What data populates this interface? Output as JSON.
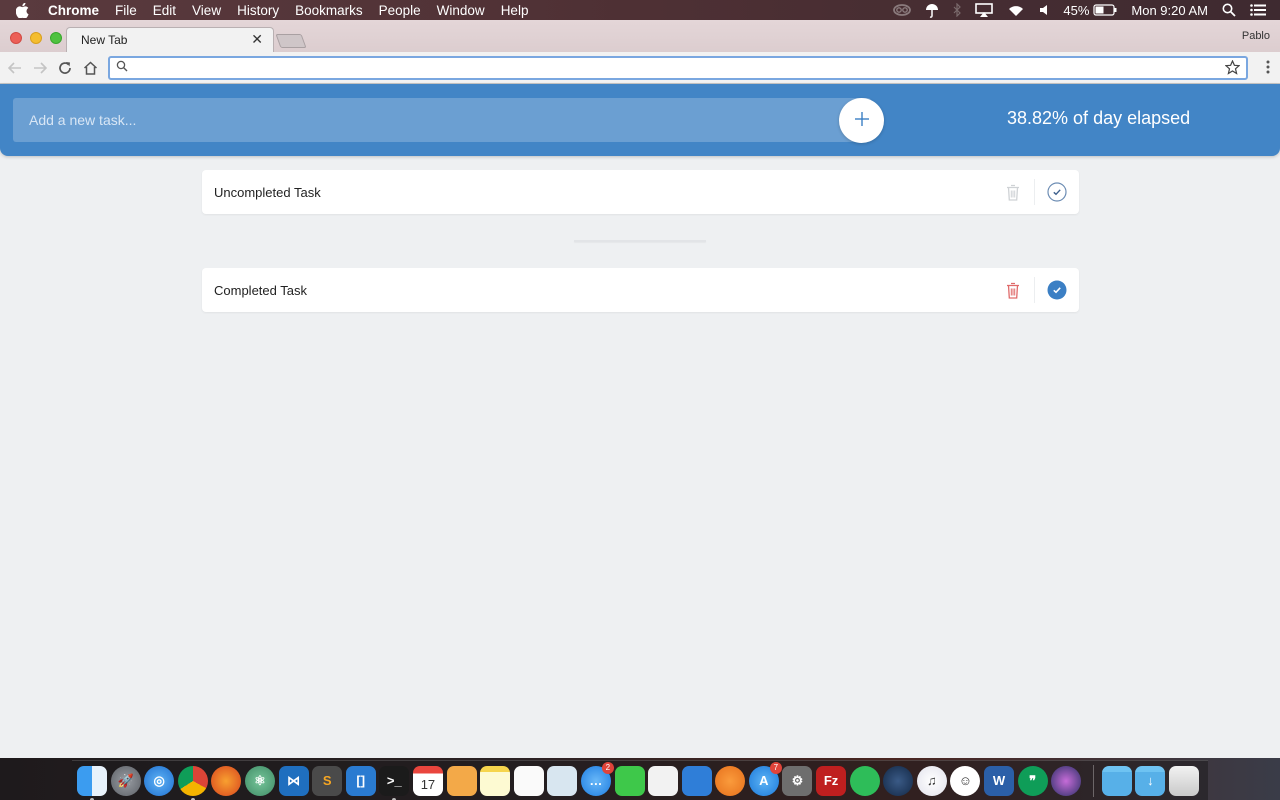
{
  "menubar": {
    "app_name": "Chrome",
    "items": [
      "File",
      "Edit",
      "View",
      "History",
      "Bookmarks",
      "People",
      "Window",
      "Help"
    ],
    "status": {
      "battery": "45%",
      "clock": "Mon 9:20 AM"
    },
    "status_icons": [
      "creative-cloud-icon",
      "umbrella-icon",
      "bluetooth-icon",
      "airplay-icon",
      "wifi-icon",
      "volume-icon",
      "battery-icon",
      "spotlight-icon",
      "notification-center-icon"
    ]
  },
  "browser": {
    "tab_title": "New Tab",
    "profile_name": "Pablo",
    "omnibox_value": "",
    "colors": {
      "omnibox_focus": "#7aa7e0"
    }
  },
  "app": {
    "new_task_placeholder": "Add a new task...",
    "add_button_icon": "plus-icon",
    "day_elapsed_text": "38.82% of day elapsed",
    "day_elapsed_percent": 38.82,
    "colors": {
      "header": "#4285c6",
      "input_bg": "#6b9fd2",
      "background": "#eef0f2",
      "delete_active": "#e06a6a",
      "delete_inactive": "#cfd2d5",
      "check_active": "#3b7fc4"
    },
    "uncompleted_tasks": [
      {
        "label": "Uncompleted Task",
        "completed": false
      }
    ],
    "completed_tasks": [
      {
        "label": "Completed Task",
        "completed": true
      }
    ]
  },
  "dock": {
    "apps": [
      {
        "name": "Finder",
        "icon": "finder-icon",
        "running": true
      },
      {
        "name": "Launchpad",
        "icon": "launchpad-icon",
        "running": false
      },
      {
        "name": "Safari",
        "icon": "safari-icon",
        "running": false
      },
      {
        "name": "Chrome",
        "icon": "chrome-icon",
        "running": true
      },
      {
        "name": "Firefox",
        "icon": "firefox-icon",
        "running": false
      },
      {
        "name": "Atom",
        "icon": "atom-icon",
        "running": false
      },
      {
        "name": "Visual Studio Code",
        "icon": "vscode-icon",
        "running": false
      },
      {
        "name": "Sublime Text",
        "icon": "sublime-icon",
        "running": false
      },
      {
        "name": "Brackets",
        "icon": "brackets-icon",
        "running": false
      },
      {
        "name": "Terminal",
        "icon": "terminal-icon",
        "running": true
      },
      {
        "name": "Calendar",
        "icon": "calendar-icon",
        "running": false,
        "text": "17"
      },
      {
        "name": "Pages",
        "icon": "pages-icon",
        "running": false
      },
      {
        "name": "Notes",
        "icon": "notes-icon",
        "running": false
      },
      {
        "name": "Reminders",
        "icon": "reminders-icon",
        "running": false
      },
      {
        "name": "Preview",
        "icon": "preview-icon",
        "running": false
      },
      {
        "name": "Messages",
        "icon": "messages-icon",
        "running": false,
        "badge": "2"
      },
      {
        "name": "FaceTime",
        "icon": "facetime-icon",
        "running": false
      },
      {
        "name": "Numbers",
        "icon": "numbers-icon",
        "running": false
      },
      {
        "name": "Keynote",
        "icon": "keynote-icon",
        "running": false
      },
      {
        "name": "iBooks",
        "icon": "ibooks-icon",
        "running": false
      },
      {
        "name": "App Store",
        "icon": "app-store-icon",
        "running": false,
        "badge": "7"
      },
      {
        "name": "System Preferences",
        "icon": "system-preferences-icon",
        "running": false
      },
      {
        "name": "FileZilla",
        "icon": "filezilla-icon",
        "running": false
      },
      {
        "name": "Spotify",
        "icon": "spotify-icon",
        "running": false
      },
      {
        "name": "Steam",
        "icon": "steam-icon",
        "running": false
      },
      {
        "name": "iTunes",
        "icon": "itunes-icon",
        "running": false
      },
      {
        "name": "Smiley",
        "icon": "smiley-icon",
        "running": false
      },
      {
        "name": "Word",
        "icon": "word-icon",
        "running": false
      },
      {
        "name": "Hangouts",
        "icon": "hangouts-icon",
        "running": false
      },
      {
        "name": "Siri",
        "icon": "siri-icon",
        "running": false
      }
    ],
    "folders": [
      {
        "name": "Documents",
        "icon": "folder-icon"
      },
      {
        "name": "Downloads",
        "icon": "downloads-folder-icon"
      },
      {
        "name": "Trash",
        "icon": "trash-bin-icon"
      }
    ]
  }
}
